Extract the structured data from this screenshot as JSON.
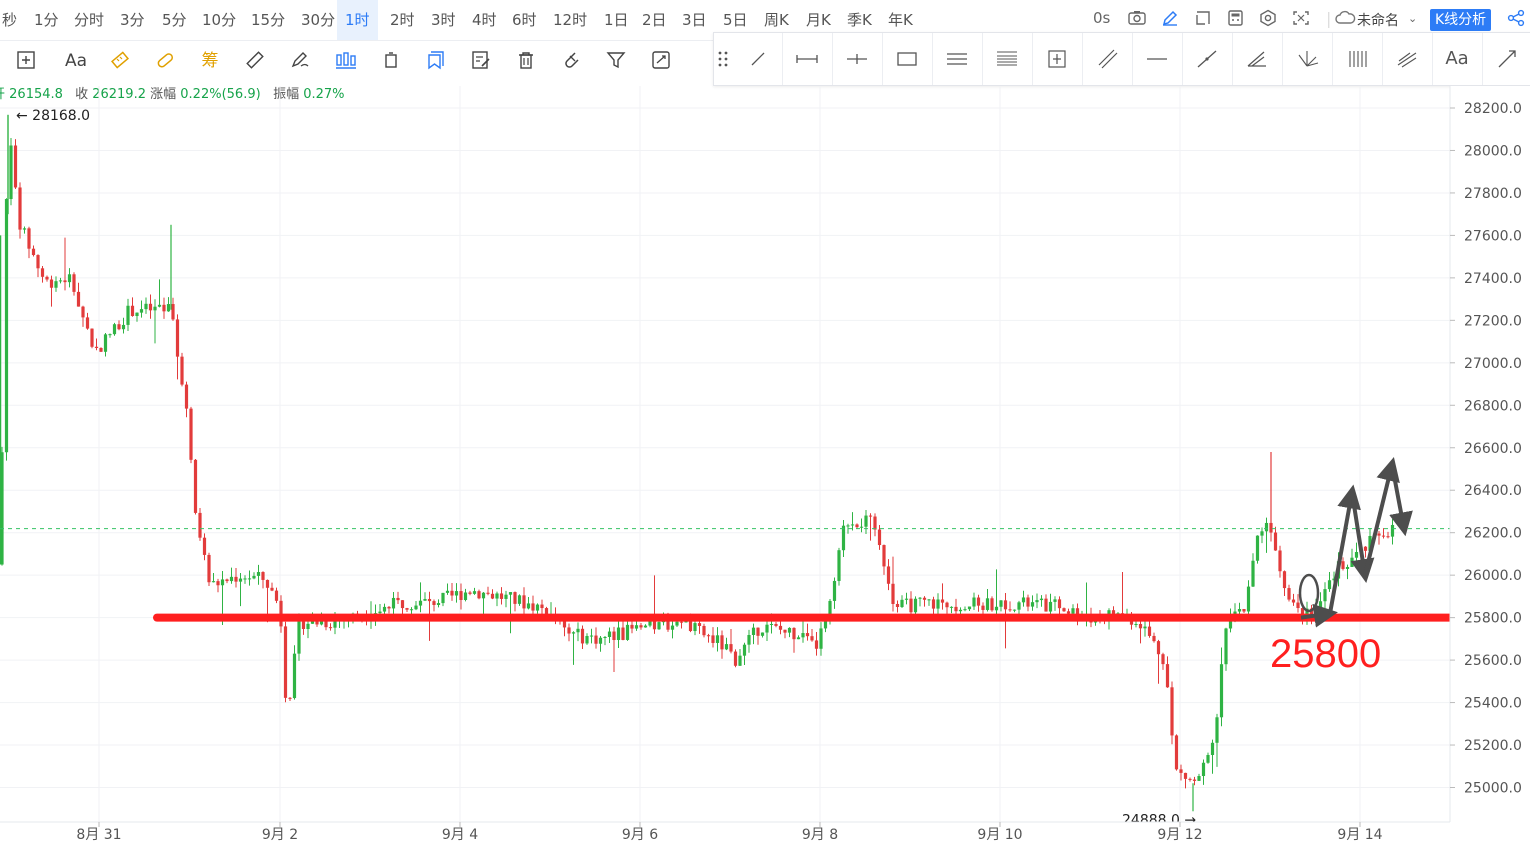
{
  "timeframes": [
    "秒",
    "1分",
    "分时",
    "3分",
    "5分",
    "10分",
    "15分",
    "30分",
    "1时",
    "2时",
    "3时",
    "4时",
    "6时",
    "12时",
    "1日",
    "2日",
    "3日",
    "5日",
    "周K",
    "月K",
    "季K",
    "年K"
  ],
  "active_timeframe": "1时",
  "top_right": {
    "countdown": "0s",
    "layout_name": "未命名",
    "analysis_label": "K线分析"
  },
  "info": {
    "open_label": "开",
    "open_value": "26154.8",
    "close_label": "收",
    "close_value": "26219.2",
    "change_label": "涨幅",
    "change_value": "0.22%(56.9)",
    "amplitude_label": "振幅",
    "amplitude_value": "0.27%"
  },
  "drawing_tools": [
    "trend-line",
    "horizontal-ray",
    "cross-line",
    "rectangle",
    "parallel-channel",
    "fibonacci",
    "measure",
    "price-range",
    "horizontal-segment",
    "extended-line",
    "angle-line",
    "fan-line",
    "gann-grid",
    "pitchfork",
    "text",
    "arrow-line"
  ],
  "colors": {
    "up": "#2fb344",
    "down": "#e23b3b",
    "support": "#ff1f1f",
    "annotation": "#4d4d4d",
    "price_tag": "#34c263"
  },
  "chart_data": {
    "type": "candlestick",
    "y_ticks": [
      "28200.0",
      "28000.0",
      "27800.0",
      "27600.0",
      "27400.0",
      "27200.0",
      "27000.0",
      "26800.0",
      "26600.0",
      "26400.0",
      "26200.0",
      "26000.0",
      "25800.0",
      "25600.0",
      "25400.0",
      "25200.0",
      "25000.0"
    ],
    "ylim": [
      24860,
      28210
    ],
    "x_ticks": [
      "8月 31",
      "9月 2",
      "9月 4",
      "9月 6",
      "9月 8",
      "9月 10",
      "9月 12",
      "9月 14"
    ],
    "last_price": "26219.2",
    "high_marker": "28168.0",
    "low_marker": "24888.0",
    "support_level": 25800,
    "support_label": "25800",
    "price_path": [
      [
        0,
        26050
      ],
      [
        8,
        28168
      ],
      [
        20,
        27650
      ],
      [
        45,
        27380
      ],
      [
        70,
        27400
      ],
      [
        95,
        27050
      ],
      [
        130,
        27250
      ],
      [
        170,
        27250
      ],
      [
        185,
        26850
      ],
      [
        195,
        26300
      ],
      [
        210,
        25950
      ],
      [
        240,
        26000
      ],
      [
        265,
        25980
      ],
      [
        280,
        25850
      ],
      [
        287,
        25350
      ],
      [
        300,
        25780
      ],
      [
        330,
        25780
      ],
      [
        370,
        25820
      ],
      [
        400,
        25870
      ],
      [
        440,
        25880
      ],
      [
        470,
        25930
      ],
      [
        500,
        25900
      ],
      [
        540,
        25850
      ],
      [
        570,
        25720
      ],
      [
        600,
        25700
      ],
      [
        640,
        25750
      ],
      [
        680,
        25780
      ],
      [
        720,
        25680
      ],
      [
        735,
        25600
      ],
      [
        760,
        25760
      ],
      [
        800,
        25720
      ],
      [
        815,
        25650
      ],
      [
        830,
        25850
      ],
      [
        845,
        26250
      ],
      [
        870,
        26250
      ],
      [
        885,
        26050
      ],
      [
        895,
        25850
      ],
      [
        930,
        25870
      ],
      [
        970,
        25860
      ],
      [
        1010,
        25870
      ],
      [
        1060,
        25850
      ],
      [
        1090,
        25800
      ],
      [
        1115,
        25820
      ],
      [
        1140,
        25780
      ],
      [
        1165,
        25600
      ],
      [
        1175,
        25080
      ],
      [
        1195,
        25020
      ],
      [
        1215,
        25200
      ],
      [
        1225,
        25750
      ],
      [
        1245,
        25850
      ],
      [
        1255,
        26150
      ],
      [
        1270,
        26250
      ],
      [
        1285,
        25950
      ],
      [
        1300,
        25830
      ],
      [
        1320,
        25860
      ],
      [
        1340,
        26050
      ],
      [
        1360,
        26100
      ],
      [
        1380,
        26200
      ],
      [
        1395,
        26219
      ]
    ],
    "annotation_zigzag": [
      [
        1301,
        25800
      ],
      [
        1330,
        25820
      ],
      [
        1352,
        26390
      ],
      [
        1365,
        26000
      ],
      [
        1392,
        26520
      ],
      [
        1404,
        26220
      ]
    ]
  }
}
